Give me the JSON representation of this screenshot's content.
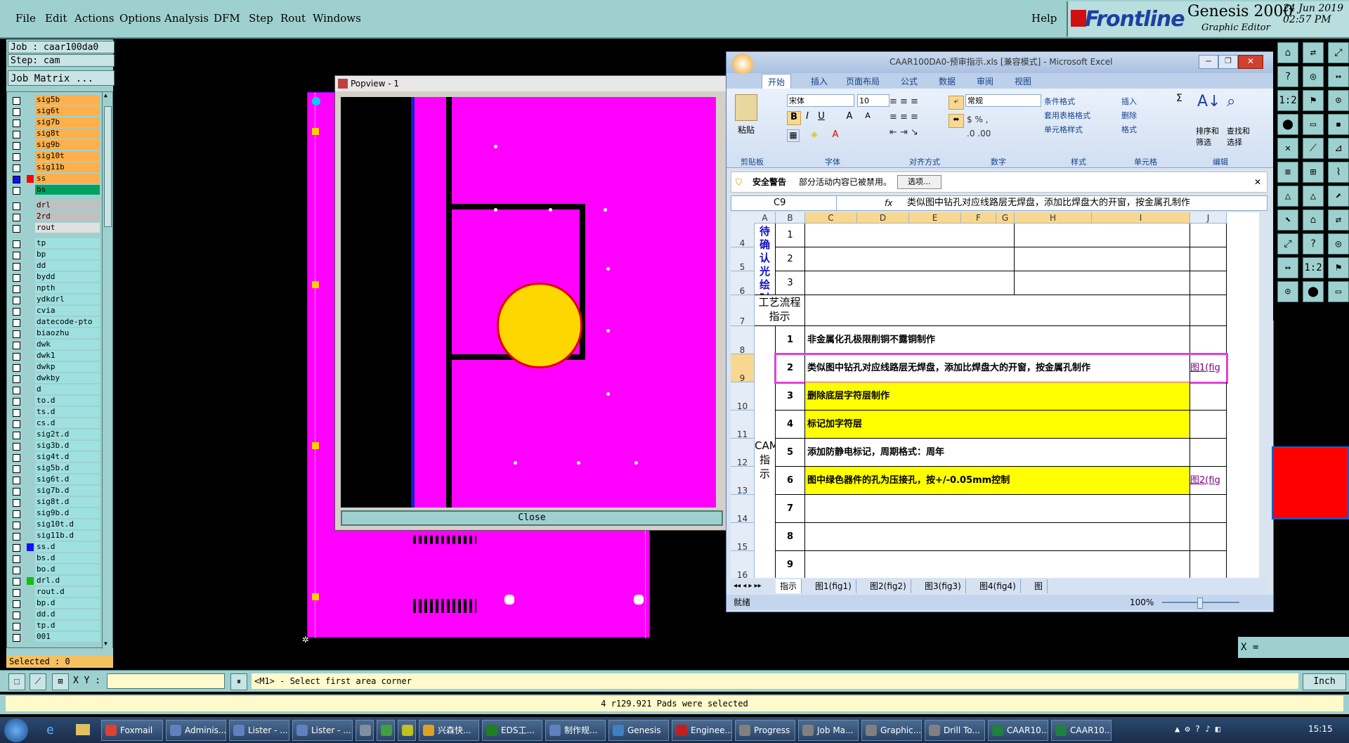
{
  "menubar": {
    "items": [
      "File",
      "Edit",
      "Actions",
      "Options",
      "Analysis",
      "DFM",
      "Step",
      "Rout",
      "Windows"
    ],
    "help": "Help",
    "brand_logo": "Frontline",
    "brand_title": "Genesis 2000",
    "brand_sub": "Graphic Editor",
    "date": "24 Jun 2019",
    "time": "02:57 PM"
  },
  "job": {
    "job_label": "Job : caar100da0",
    "step_label": "Step: cam",
    "matrix_button": "Job Matrix ...",
    "layers": [
      {
        "name": "sig5b",
        "color": "#ffb04a",
        "checkbox": "off"
      },
      {
        "name": "sig6t",
        "color": "#ffb04a",
        "checkbox": "off"
      },
      {
        "name": "sig7b",
        "color": "#ffb04a",
        "checkbox": "off"
      },
      {
        "name": "sig8t",
        "color": "#ffb04a",
        "checkbox": "off"
      },
      {
        "name": "sig9b",
        "color": "#ffb04a",
        "checkbox": "off"
      },
      {
        "name": "sig10t",
        "color": "#ffb04a",
        "checkbox": "off"
      },
      {
        "name": "sig11b",
        "color": "#ffb04a",
        "checkbox": "off"
      },
      {
        "name": "ss",
        "color": "#ffb04a",
        "checkbox": "on",
        "swatch": "#ff0000"
      },
      {
        "name": "bs",
        "color": "#00a060",
        "checkbox": "off"
      },
      {
        "name": "drl",
        "color": "#c0c0c0",
        "checkbox": "off"
      },
      {
        "name": "2rd",
        "color": "#c0c0c0",
        "checkbox": "off"
      },
      {
        "name": "rout",
        "color": "#e0e0e0",
        "checkbox": "off"
      },
      {
        "name": "tp",
        "color": "#9fe0e0",
        "checkbox": "off"
      },
      {
        "name": "bp",
        "color": "#9fe0e0",
        "checkbox": "off"
      },
      {
        "name": "dd",
        "color": "#9fe0e0",
        "checkbox": "off"
      },
      {
        "name": "bydd",
        "color": "#9fe0e0",
        "checkbox": "off"
      },
      {
        "name": "npth",
        "color": "#9fe0e0",
        "checkbox": "off"
      },
      {
        "name": "ydkdrl",
        "color": "#9fe0e0",
        "checkbox": "off"
      },
      {
        "name": "cvia",
        "color": "#9fe0e0",
        "checkbox": "off"
      },
      {
        "name": "datecode-pto",
        "color": "#9fe0e0",
        "checkbox": "off"
      },
      {
        "name": "biaozhu",
        "color": "#9fe0e0",
        "checkbox": "off"
      },
      {
        "name": "dwk",
        "color": "#9fe0e0",
        "checkbox": "off"
      },
      {
        "name": "dwk1",
        "color": "#9fe0e0",
        "checkbox": "off"
      },
      {
        "name": "dwkp",
        "color": "#9fe0e0",
        "checkbox": "off"
      },
      {
        "name": "dwkby",
        "color": "#9fe0e0",
        "checkbox": "off"
      },
      {
        "name": "d",
        "color": "#9fe0e0",
        "checkbox": "off"
      },
      {
        "name": "to.d",
        "color": "#9fe0e0",
        "checkbox": "off"
      },
      {
        "name": "ts.d",
        "color": "#9fe0e0",
        "checkbox": "off"
      },
      {
        "name": "cs.d",
        "color": "#9fe0e0",
        "checkbox": "off"
      },
      {
        "name": "sig2t.d",
        "color": "#9fe0e0",
        "checkbox": "off"
      },
      {
        "name": "sig3b.d",
        "color": "#9fe0e0",
        "checkbox": "off"
      },
      {
        "name": "sig4t.d",
        "color": "#9fe0e0",
        "checkbox": "off"
      },
      {
        "name": "sig5b.d",
        "color": "#9fe0e0",
        "checkbox": "off"
      },
      {
        "name": "sig6t.d",
        "color": "#9fe0e0",
        "checkbox": "off"
      },
      {
        "name": "sig7b.d",
        "color": "#9fe0e0",
        "checkbox": "off"
      },
      {
        "name": "sig8t.d",
        "color": "#9fe0e0",
        "checkbox": "off"
      },
      {
        "name": "sig9b.d",
        "color": "#9fe0e0",
        "checkbox": "off"
      },
      {
        "name": "sig10t.d",
        "color": "#9fe0e0",
        "checkbox": "off"
      },
      {
        "name": "sig11b.d",
        "color": "#9fe0e0",
        "checkbox": "off"
      },
      {
        "name": "ss.d",
        "color": "#9fe0e0",
        "checkbox": "off",
        "swatch": "#1010ff"
      },
      {
        "name": "bs.d",
        "color": "#9fe0e0",
        "checkbox": "off"
      },
      {
        "name": "bo.d",
        "color": "#9fe0e0",
        "checkbox": "off"
      },
      {
        "name": "drl.d",
        "color": "#9fe0e0",
        "checkbox": "off",
        "swatch": "#10c010"
      },
      {
        "name": "rout.d",
        "color": "#9fe0e0",
        "checkbox": "off"
      },
      {
        "name": "bp.d",
        "color": "#9fe0e0",
        "checkbox": "off"
      },
      {
        "name": "dd.d",
        "color": "#9fe0e0",
        "checkbox": "off"
      },
      {
        "name": "tp.d",
        "color": "#9fe0e0",
        "checkbox": "off"
      },
      {
        "name": "001",
        "color": "#9fe0e0",
        "checkbox": "off"
      }
    ],
    "selected": "Selected : 0"
  },
  "popview": {
    "title": "Popview - 1",
    "close_label": "Close"
  },
  "excel": {
    "title": "CAAR100DA0-预审指示.xls [兼容模式] - Microsoft Excel",
    "tabs": [
      "开始",
      "插入",
      "页面布局",
      "公式",
      "数据",
      "审阅",
      "视图"
    ],
    "groups": [
      "剪贴板",
      "字体",
      "对齐方式",
      "数字",
      "样式",
      "单元格",
      "编辑"
    ],
    "paste_label": "粘贴",
    "font_name": "宋体",
    "font_size": "10",
    "number_format": "常规",
    "style_items": [
      "条件格式",
      "套用表格格式",
      "单元格样式"
    ],
    "cell_items": [
      "插入",
      "删除",
      "格式"
    ],
    "edit_items": [
      "排序和筛选",
      "查找和选择"
    ],
    "security_label": "安全警告",
    "security_text": "部分活动内容已被禁用。",
    "options_button": "选项...",
    "name_box": "C9",
    "fx": "fx",
    "formula": "类似图中钻孔对应线路层无焊盘，添加比焊盘大的开窗，按金属孔制作",
    "columns": [
      "A",
      "B",
      "C",
      "D",
      "E",
      "F",
      "G",
      "H",
      "I",
      "J"
    ],
    "rows": [
      "4",
      "5",
      "6",
      "7",
      "8",
      "9",
      "10",
      "11",
      "12",
      "13",
      "14",
      "15",
      "16"
    ],
    "section_confirm": "待确认光绘时一起确认问题",
    "confirm_nums": [
      "1",
      "2",
      "3"
    ],
    "section_process": "工艺流程指示",
    "section_cam": "CAM指示",
    "cam_rows": [
      {
        "num": "1",
        "text": "非金属化孔极限削铜不露铜制作",
        "highlight": "none",
        "link": ""
      },
      {
        "num": "2",
        "text": "类似图中钻孔对应线路层无焊盘，添加比焊盘大的开窗，按金属孔制作",
        "highlight": "selected",
        "link": "图1(fig"
      },
      {
        "num": "3",
        "text": "删除底层字符层制作",
        "highlight": "yellow",
        "link": ""
      },
      {
        "num": "4",
        "text": "标记加字符层",
        "highlight": "yellow",
        "link": ""
      },
      {
        "num": "5",
        "text": "添加防静电标记，周期格式：周年",
        "highlight": "none",
        "link": ""
      },
      {
        "num": "6",
        "text": "图中绿色器件的孔为压接孔，按+/-0.05mm控制",
        "highlight": "yellow",
        "link": "图2(fig"
      },
      {
        "num": "7",
        "text": "",
        "highlight": "none",
        "link": ""
      },
      {
        "num": "8",
        "text": "",
        "highlight": "none",
        "link": ""
      },
      {
        "num": "9",
        "text": "",
        "highlight": "none",
        "link": ""
      }
    ],
    "sheet_tabs": [
      "指示",
      "图1(fig1)",
      "图2(fig2)",
      "图3(fig3)",
      "图4(fig4)",
      "图"
    ],
    "status": "就绪",
    "zoom": "100%"
  },
  "cmd": {
    "xy_label": "X Y :",
    "xy_value": "",
    "message": "<M1> - Select first area corner",
    "units": "Inch",
    "x_label": "X ="
  },
  "status": "4 r129.921 Pads were selected",
  "taskbar": {
    "items": [
      "Foxmail",
      "Adminis...",
      "Lister - ...",
      "Lister - ...",
      "",
      "",
      "",
      "兴森快...",
      "EDS工...",
      "制作规...",
      "Genesis",
      "Enginee...",
      "Progress",
      "Job Ma...",
      "Graphic...",
      "Drill To...",
      "CAAR10...",
      "CAAR10..."
    ],
    "clock": "15:15"
  }
}
